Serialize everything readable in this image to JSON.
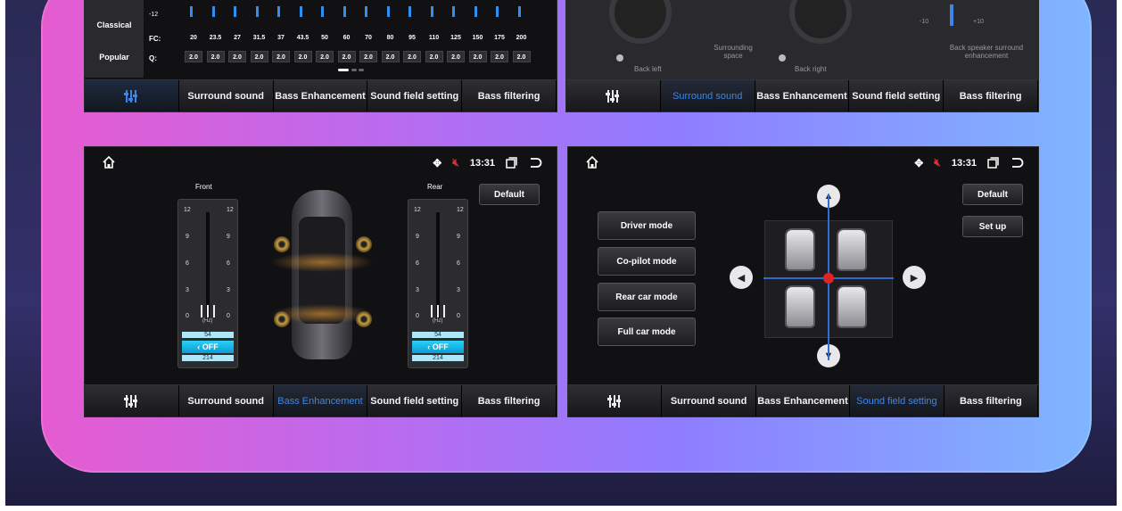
{
  "tabs": {
    "surround": "Surround sound",
    "bass": "Bass Enhancement",
    "sound_field": "Sound field setting",
    "bass_filtering": "Bass filtering"
  },
  "eq_panel": {
    "presets": [
      "Classical",
      "Popular"
    ],
    "scale_label": "-12",
    "fc_label": "FC:",
    "q_label": "Q:",
    "fc_values": [
      "20",
      "23.5",
      "27",
      "31.5",
      "37",
      "43.5",
      "50",
      "60",
      "70",
      "80",
      "95",
      "110",
      "125",
      "150",
      "175",
      "200"
    ],
    "q_values": [
      "2.0",
      "2.0",
      "2.0",
      "2.0",
      "2.0",
      "2.0",
      "2.0",
      "2.0",
      "2.0",
      "2.0",
      "2.0",
      "2.0",
      "2.0",
      "2.0",
      "2.0",
      "2.0"
    ],
    "active_tab": "eq"
  },
  "surround_panel": {
    "back_left": "Back left",
    "surrounding_space": "Surrounding space",
    "back_right": "Back right",
    "back_speaker": "Back speaker surround enhancement",
    "minus_label": "-10",
    "plus_label": "+10",
    "active_tab": "surround"
  },
  "bass_panel": {
    "time": "13:31",
    "front_label": "Front",
    "rear_label": "Rear",
    "default_btn": "Default",
    "ticks": [
      "12",
      "9",
      "6",
      "3",
      "0"
    ],
    "hz_label": "(Hz)",
    "picker_above": "54",
    "picker_selected": "OFF",
    "picker_below": "214",
    "active_tab": "bass"
  },
  "field_panel": {
    "time": "13:31",
    "default_btn": "Default",
    "setup_btn": "Set up",
    "modes": [
      "Driver mode",
      "Co-pilot mode",
      "Rear car mode",
      "Full car mode"
    ],
    "active_tab": "sound_field"
  },
  "colors": {
    "active_tab": "#3d86e6",
    "accent_red": "#e03030",
    "picker_blue": "#15b4e8"
  }
}
